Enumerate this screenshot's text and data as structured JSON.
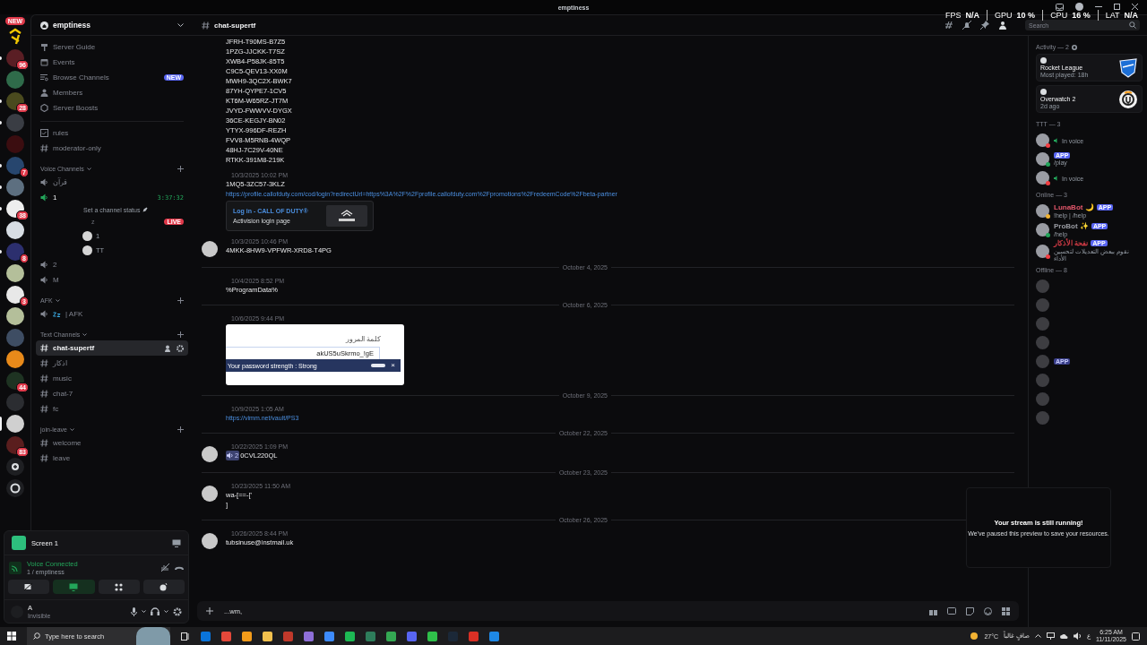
{
  "window": {
    "title": "emptiness"
  },
  "overlay_stats": [
    {
      "label": "FPS",
      "value": "N/A"
    },
    {
      "label": "GPU",
      "value": "10 %"
    },
    {
      "label": "CPU",
      "value": "16 %"
    },
    {
      "label": "LAT",
      "value": "N/A"
    }
  ],
  "server_rail": {
    "new_badge": "NEW",
    "servers": [
      {
        "kind": "logo",
        "unread": false,
        "selected": false
      },
      {
        "kind": "server",
        "color": "#5a1e24",
        "badge": "96",
        "unread": true,
        "selected": false
      },
      {
        "kind": "server",
        "color": "#2f6b4a",
        "unread": false,
        "selected": false
      },
      {
        "kind": "server",
        "color": "#4a4a1e",
        "badge": "28",
        "unread": true,
        "selected": false
      },
      {
        "kind": "server",
        "color": "#3a3d44",
        "unread": true,
        "selected": false
      },
      {
        "kind": "server",
        "color": "#3b0d10",
        "unread": false,
        "selected": false
      },
      {
        "kind": "server",
        "color": "#27466e",
        "badge": "7",
        "unread": true,
        "selected": false
      },
      {
        "kind": "server",
        "color": "#5d6f80",
        "unread": true,
        "selected": false
      },
      {
        "kind": "server",
        "color": "#eeeeee",
        "badge": "38",
        "unread": true,
        "selected": false
      },
      {
        "kind": "server",
        "color": "#d7dde3",
        "unread": false,
        "selected": false
      },
      {
        "kind": "server",
        "color": "#2c2f6e",
        "badge": "8",
        "unread": true,
        "selected": false
      },
      {
        "kind": "server",
        "color": "#b4bf9a",
        "unread": false,
        "selected": false
      },
      {
        "kind": "server",
        "color": "#e8e8e8",
        "badge": "3",
        "unread": false,
        "selected": false
      },
      {
        "kind": "server",
        "color": "#b4bf9a",
        "unread": false,
        "selected": false
      },
      {
        "kind": "server",
        "color": "#3e4d63",
        "unread": false,
        "selected": false
      },
      {
        "kind": "server",
        "color": "#e88a1a",
        "unread": false,
        "selected": false
      },
      {
        "kind": "server",
        "color": "#1e3322",
        "badge": "44",
        "unread": false,
        "selected": false
      },
      {
        "kind": "server",
        "color": "#2b2d31",
        "unread": false,
        "selected": false
      },
      {
        "kind": "server",
        "color": "#d0d0d0",
        "unread": false,
        "selected": true
      },
      {
        "kind": "server",
        "color": "#5a1e1e",
        "badge": "83",
        "unread": false,
        "selected": false
      },
      {
        "kind": "add",
        "unread": false,
        "selected": false
      },
      {
        "kind": "discover",
        "unread": false,
        "selected": false
      }
    ]
  },
  "sidebar": {
    "server_name": "emptiness",
    "nav": [
      {
        "kind": "guide",
        "label": "Server Guide"
      },
      {
        "kind": "events",
        "label": "Events"
      },
      {
        "kind": "browse",
        "label": "Browse Channels",
        "badge": "NEW"
      },
      {
        "kind": "members",
        "label": "Members"
      },
      {
        "kind": "boosts",
        "label": "Server Boosts"
      }
    ],
    "sections": [
      {
        "channels": [
          {
            "kind": "rules",
            "name": "rules",
            "selected": false
          },
          {
            "kind": "text",
            "name": "moderator-only",
            "selected": false
          }
        ]
      },
      {
        "title": "Voice Channels",
        "channels": [
          {
            "kind": "voice",
            "name": "قرآن",
            "selected": false
          },
          {
            "kind": "voice-active",
            "name": "1",
            "timer": "3:37:32",
            "status": "Set a channel status",
            "selected": false,
            "users": [
              {
                "name": "z",
                "badge": "LIVE"
              },
              {
                "name": "1"
              },
              {
                "name": "TT"
              }
            ]
          },
          {
            "kind": "voice",
            "name": "2",
            "selected": false
          },
          {
            "kind": "voice",
            "name": "M",
            "selected": false
          }
        ]
      },
      {
        "title": "AFK",
        "channels": [
          {
            "kind": "afk",
            "name": "| AFK",
            "selected": false
          }
        ]
      },
      {
        "title": "Text Channels",
        "channels": [
          {
            "kind": "text",
            "name": "chat-supertf",
            "selected": true
          },
          {
            "kind": "text",
            "name": "اذكار",
            "selected": false
          },
          {
            "kind": "text",
            "name": "music",
            "selected": false
          },
          {
            "kind": "text",
            "name": "chat-7",
            "selected": false
          },
          {
            "kind": "text",
            "name": "fc",
            "selected": false
          }
        ]
      },
      {
        "title": "join-leave",
        "channels": [
          {
            "kind": "text",
            "name": "welcome",
            "selected": false
          },
          {
            "kind": "text",
            "name": "leave",
            "selected": false
          }
        ]
      }
    ]
  },
  "voice_panel": {
    "stream": "Screen 1",
    "state": "Voice Connected",
    "channel": "1 / emptiness",
    "user": {
      "name": "A",
      "status": "Invisible"
    }
  },
  "chat": {
    "channel": "chat-supertf",
    "search": {
      "placeholder": "Search"
    },
    "feed": [
      {
        "kind": "lines",
        "lines": [
          "JFRH-T90MS-B7Z5",
          "1PZG-JJCKK-T7SZ",
          "XWB4-P58JK-85T5",
          "C9C5-QEV13-XX0M",
          "MWH9-3QC2X-BWK7",
          "87YH-QYPE7-1CV5",
          "KT6M-W65RZ-JT7M",
          "JVYD-FWWVV-DYGX",
          "36CE-KEGJY-BN02",
          "YTYX-996DF-REZH",
          "FVV8-M5RNB-4WQP",
          "48HJ-7C29V-40NE",
          "RTKK-391M8-219K"
        ]
      },
      {
        "kind": "message",
        "avatar": false,
        "timestamp": "10/3/2025 10:02 PM",
        "lines": [
          "1MQ5-3ZC57-3KLZ"
        ],
        "link": "https://profile.callofduty.com/cod/login?redirectUrl=https%3A%2F%2Fprofile.callofduty.com%2Fpromotions%2FredeemCode%2Fbeta-partner",
        "embed": {
          "title": "Log in - CALL OF DUTY®",
          "description": "Activision login page"
        }
      },
      {
        "kind": "message",
        "avatar": true,
        "timestamp": "10/3/2025 10:46 PM",
        "lines": [
          "4MKK-8HW9-VPFWR-XRD8-T4PG"
        ]
      },
      {
        "kind": "date",
        "label": "October 4, 2025"
      },
      {
        "kind": "message",
        "avatar": false,
        "timestamp": "10/4/2025 8:52 PM",
        "lines": [
          "%ProgramData%"
        ]
      },
      {
        "kind": "date",
        "label": "October 6, 2025"
      },
      {
        "kind": "message",
        "avatar": false,
        "timestamp": "10/6/2025 9:44 PM",
        "screenshot": {
          "label": "كلمة المرور",
          "value": "akUS5uSkrmo_!gE",
          "strength": "Your password strength :  Strong",
          "level": 1,
          "close": "×"
        }
      },
      {
        "kind": "date",
        "label": "October 9, 2025"
      },
      {
        "kind": "message",
        "avatar": false,
        "timestamp": "10/9/2025 1:05 AM",
        "link": "https://vimm.net/vault/PS3"
      },
      {
        "kind": "date",
        "label": "October 22, 2025"
      },
      {
        "kind": "message",
        "avatar": true,
        "timestamp": "10/22/2025 1:09 PM",
        "mention": "2",
        "lines": [
          "0CVL220QL"
        ]
      },
      {
        "kind": "date",
        "label": "October 23, 2025"
      },
      {
        "kind": "message",
        "avatar": true,
        "timestamp": "10/23/2025 11:50 AM",
        "lines": [
          "wa-[==-['",
          "]"
        ]
      },
      {
        "kind": "date",
        "label": "October 26, 2025"
      },
      {
        "kind": "message",
        "avatar": true,
        "timestamp": "10/26/2025 8:44 PM",
        "lines": [
          "tubsinuse@instmail.uk"
        ]
      }
    ],
    "input": {
      "value": "...wm,"
    }
  },
  "members": {
    "activity_title": "Activity — 2",
    "activities": [
      {
        "kind": "shield",
        "game": "Rocket League",
        "detail": "Most played: 18h"
      },
      {
        "kind": "ring",
        "game": "Overwatch 2",
        "detail": "2d ago"
      }
    ],
    "groups": [
      {
        "title": "TTT — 3",
        "members": [
          {
            "status": {
              "color": "#f23f43"
            },
            "activity": "In voice",
            "voice": true
          },
          {
            "status": {
              "color": "#23a55a"
            },
            "activity": "/play",
            "app": "APP",
            "voice": false
          },
          {
            "status": {
              "color": "#f23f43"
            },
            "activity": "In voice",
            "voice": true
          }
        ]
      },
      {
        "title": "Online — 3",
        "members": [
          {
            "name": "LunaBot 🌙",
            "color": "#e2566a",
            "status": {
              "color": "#f0b232"
            },
            "app": "APP",
            "activity": "!help | /help",
            "voice": false
          },
          {
            "name": "ProBot ✨",
            "color": "#9a9ca3",
            "status": {
              "color": "#23a55a"
            },
            "app": "APP",
            "activity": "/help",
            "voice": false
          },
          {
            "name": "نفحة الأذكار",
            "color": "#d13b45",
            "status": {
              "color": "#f23f43"
            },
            "app": "APP",
            "activity": "نقوم ببعض التعديلات لتحسين الأداء",
            "voice": false
          }
        ]
      },
      {
        "title": "Offline — 8",
        "members": [
          {
            "voice": false
          },
          {
            "voice": false
          },
          {
            "voice": false
          },
          {
            "voice": false
          },
          {
            "app": "APP",
            "voice": false
          },
          {
            "voice": false
          },
          {
            "voice": false
          },
          {
            "voice": false
          }
        ]
      }
    ]
  },
  "toast": {
    "title": "Your stream is still running!",
    "body": "We've paused this preview to save your resources."
  },
  "taskbar": {
    "search": {
      "placeholder": "Type here to search"
    },
    "apps": [
      {
        "color": "#0a74da"
      },
      {
        "color": "#e3483a"
      },
      {
        "color": "#f29b1a"
      },
      {
        "color": "#f2c14e"
      },
      {
        "color": "#c0392b"
      },
      {
        "color": "#8e6fd8"
      },
      {
        "color": "#3d8bfd"
      },
      {
        "color": "#1db954"
      },
      {
        "color": "#2e7d5b"
      },
      {
        "color": "#34a853"
      },
      {
        "color": "#5865f2"
      },
      {
        "color": "#2fbf4a"
      },
      {
        "color": "#1b2838"
      },
      {
        "color": "#d93025"
      },
      {
        "color": "#1e88e5"
      }
    ],
    "weather": "27°C",
    "condition": "صافٍ غالباً",
    "lang": "ع",
    "time": "6:25 AM",
    "date": "11/11/2025"
  }
}
